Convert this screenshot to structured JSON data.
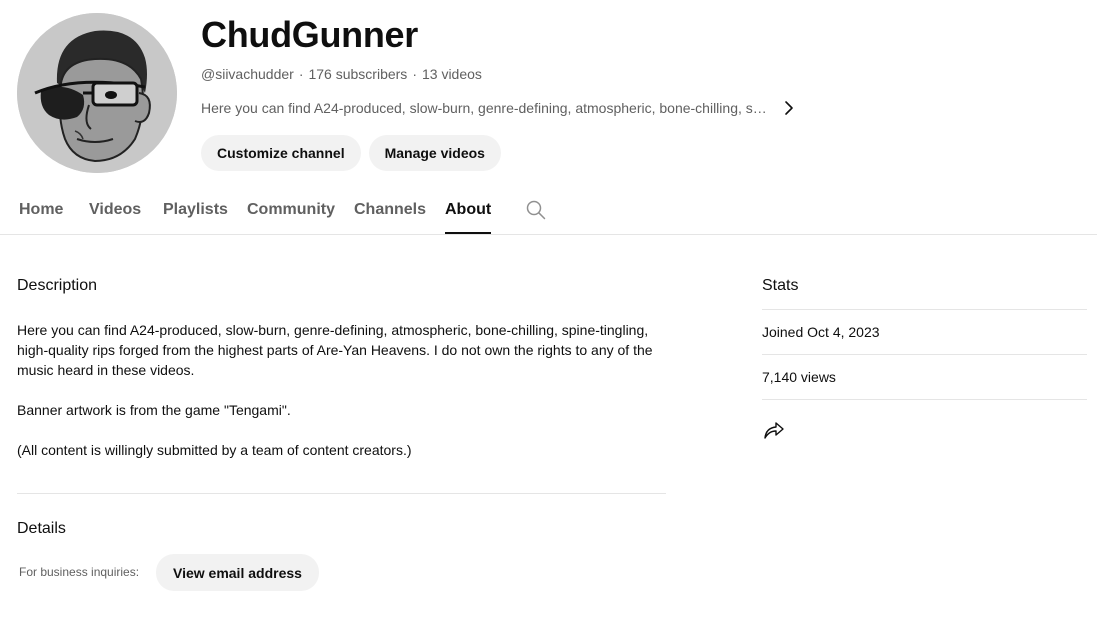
{
  "channel": {
    "name": "ChudGunner",
    "handle": "@siivachudder",
    "subscribers": "176 subscribers",
    "videos": "13 videos",
    "separator": "·",
    "description_snippet": "Here you can find A24-produced, slow-burn, genre-defining, atmospheric, bone-chilling, spi..."
  },
  "actions": {
    "customize_label": "Customize channel",
    "manage_label": "Manage videos"
  },
  "tabs": [
    {
      "label": "Home",
      "active": false
    },
    {
      "label": "Videos",
      "active": false
    },
    {
      "label": "Playlists",
      "active": false
    },
    {
      "label": "Community",
      "active": false
    },
    {
      "label": "Channels",
      "active": false
    },
    {
      "label": "About",
      "active": true
    }
  ],
  "about": {
    "description_title": "Description",
    "description_paragraphs": [
      "Here you can find A24-produced, slow-burn, genre-defining, atmospheric, bone-chilling, spine-tingling, high-quality rips forged from the highest parts of Are-Yan Heavens. I do not own the rights to any of the music heard in these videos.",
      "Banner artwork is from the game \"Tengami\".",
      "(All content is willingly submitted by a team of content creators.)"
    ],
    "details_title": "Details",
    "business_label": "For business inquiries:",
    "view_email_label": "View email address"
  },
  "stats": {
    "title": "Stats",
    "joined": "Joined Oct 4, 2023",
    "views": "7,140 views"
  },
  "icons": {
    "search": "search-icon",
    "chevron": "chevron-right-icon",
    "share": "share-icon"
  }
}
